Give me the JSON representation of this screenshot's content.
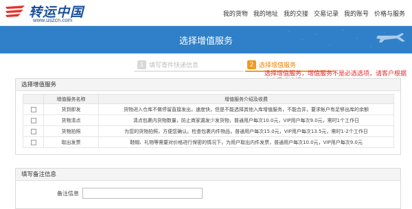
{
  "header": {
    "logo_text": "转运中国",
    "logo_url": "www.uszcn.com",
    "nav": [
      "我的货物",
      "我的地址",
      "我的交接",
      "交易记录",
      "我的账号",
      "价格与服务"
    ]
  },
  "banner": {
    "title": "选择增值服务"
  },
  "steps": [
    {
      "num": "1",
      "label": "填写寄件快递信息"
    },
    {
      "num": "2",
      "label": "选择增值服务"
    }
  ],
  "annotation": "选择增值服务，增值服务不是必选选项，请客户根据自己需求选择",
  "services_panel": {
    "title": "选择增值服务",
    "columns": [
      "",
      "增值服务名称",
      "增值服务介绍及收费"
    ],
    "rows": [
      {
        "checked": false,
        "name": "货到即发",
        "desc": "货物进入仓库不做停留直接发出，速度快，但是不能选择其他入库增值服务，不能合并，要求帐户有足够出库的余额"
      },
      {
        "checked": false,
        "name": "货物清点",
        "desc": "清点包裹内货物数量，防止商家漏发少发货物，普通用户每次10.0元，VIP用户每次9.0元，需时1个工作日"
      },
      {
        "checked": false,
        "name": "货物拍照",
        "desc": "为您的货物拍照，方便您确认。检查包裹内件物品，普通用户每次15.0元，VIP用户每次13.5元，需时1-2个工作日"
      },
      {
        "checked": false,
        "name": "取出发票",
        "desc": "鞋帽、礼物等需要对价格进行保密的情况下，为用户取出内件发票，普通用户每次10.0元，VIP用户每次9.0元"
      }
    ]
  },
  "remarks_panel": {
    "title": "填写备注信息",
    "field_label": "备注信息",
    "field_value": ""
  },
  "colors": {
    "banner": "#2f80c8",
    "accent_orange": "#f39a1d",
    "annotation_red": "#e62b2b",
    "logo_blue": "#1a4f9c"
  }
}
